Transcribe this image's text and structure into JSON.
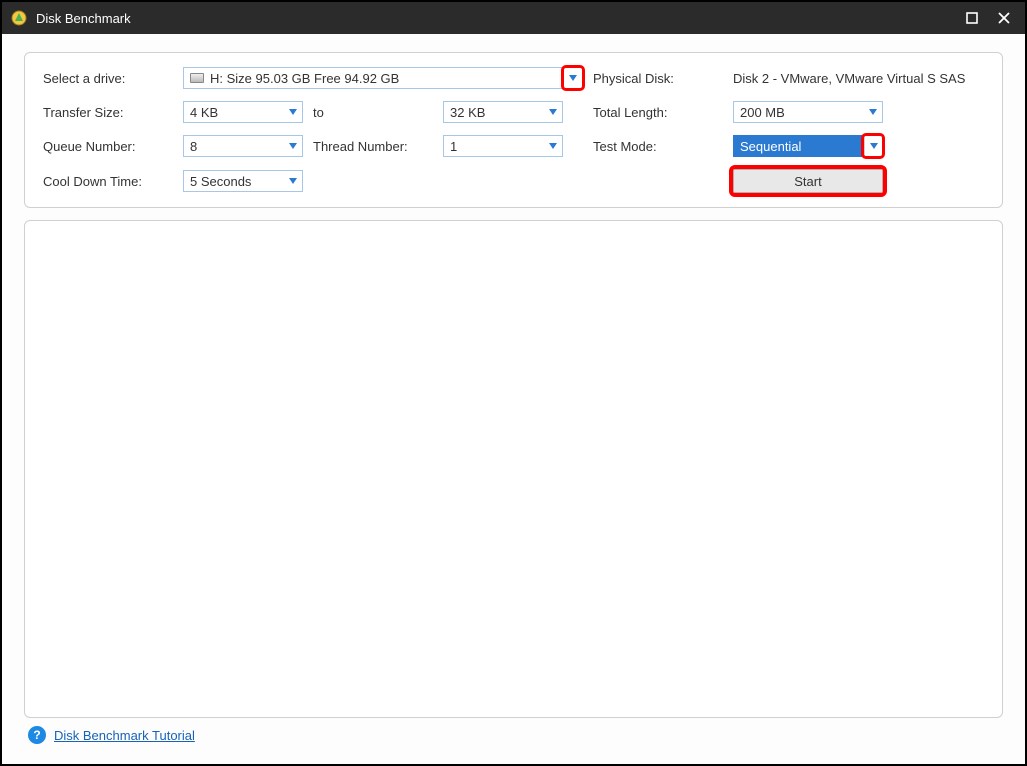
{
  "window": {
    "title": "Disk Benchmark"
  },
  "labels": {
    "select_drive": "Select a drive:",
    "physical_disk": "Physical Disk:",
    "transfer_size": "Transfer Size:",
    "to": "to",
    "total_length": "Total Length:",
    "queue_number": "Queue Number:",
    "thread_number": "Thread Number:",
    "test_mode": "Test Mode:",
    "cool_down": "Cool Down Time:"
  },
  "values": {
    "drive": "H:  Size 95.03 GB  Free 94.92 GB",
    "physical_disk": "Disk 2 - VMware, VMware Virtual S SAS",
    "transfer_from": "4 KB",
    "transfer_to": "32 KB",
    "total_length": "200 MB",
    "queue_number": "8",
    "thread_number": "1",
    "test_mode": "Sequential",
    "cool_down": "5 Seconds"
  },
  "buttons": {
    "start": "Start"
  },
  "footer": {
    "tutorial": "Disk Benchmark Tutorial",
    "help_glyph": "?"
  }
}
